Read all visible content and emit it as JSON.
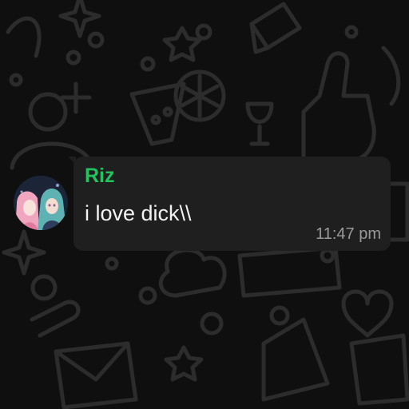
{
  "message": {
    "sender": "Riz",
    "text": "i love dick\\\\",
    "time": "11:47 pm",
    "sender_color": "#22c35e"
  },
  "avatar": {
    "icon": "anime-avatar"
  },
  "wallpaper": {
    "pattern": "doodle-wallpaper"
  }
}
